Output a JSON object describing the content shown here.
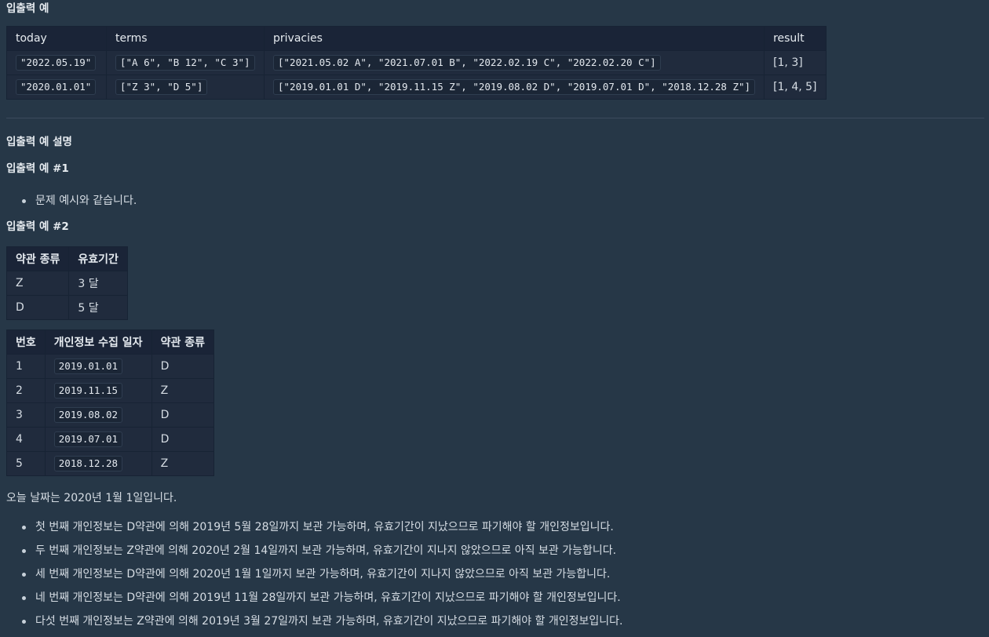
{
  "section1": {
    "title": "입출력 예",
    "headers": [
      "today",
      "terms",
      "privacies",
      "result"
    ],
    "rows": [
      {
        "today": "\"2022.05.19\"",
        "terms": "[\"A 6\", \"B 12\", \"C 3\"]",
        "privacies": "[\"2021.05.02 A\", \"2021.07.01 B\", \"2022.02.19 C\", \"2022.02.20 C\"]",
        "result": "[1, 3]"
      },
      {
        "today": "\"2020.01.01\"",
        "terms": "[\"Z 3\", \"D 5\"]",
        "privacies": "[\"2019.01.01 D\", \"2019.11.15 Z\", \"2019.08.02 D\", \"2019.07.01 D\", \"2018.12.28 Z\"]",
        "result": "[1, 4, 5]"
      }
    ]
  },
  "explain": {
    "title": "입출력 예 설명",
    "ex1": {
      "title": "입출력 예 #1",
      "bullets": [
        "문제 예시와 같습니다."
      ]
    },
    "ex2": {
      "title": "입출력 예 #2",
      "terms_headers": [
        "약관 종류",
        "유효기간"
      ],
      "terms_rows": [
        [
          "Z",
          "3 달"
        ],
        [
          "D",
          "5 달"
        ]
      ],
      "priv_headers": [
        "번호",
        "개인정보 수집 일자",
        "약관 종류"
      ],
      "priv_rows": [
        [
          "1",
          "2019.01.01",
          "D"
        ],
        [
          "2",
          "2019.11.15",
          "Z"
        ],
        [
          "3",
          "2019.08.02",
          "D"
        ],
        [
          "4",
          "2019.07.01",
          "D"
        ],
        [
          "5",
          "2018.12.28",
          "Z"
        ]
      ],
      "today_line": "오늘 날짜는 2020년 1월 1일입니다.",
      "bullets": [
        "첫 번째 개인정보는 D약관에 의해 2019년 5월 28일까지 보관 가능하며, 유효기간이 지났으므로 파기해야 할 개인정보입니다.",
        "두 번째 개인정보는 Z약관에 의해 2020년 2월 14일까지 보관 가능하며, 유효기간이 지나지 않았으므로 아직 보관 가능합니다.",
        "세 번째 개인정보는 D약관에 의해 2020년 1월 1일까지 보관 가능하며, 유효기간이 지나지 않았으므로 아직 보관 가능합니다.",
        "네 번째 개인정보는 D약관에 의해 2019년 11월 28일까지 보관 가능하며, 유효기간이 지났으므로 파기해야 할 개인정보입니다.",
        "다섯 번째 개인정보는 Z약관에 의해 2019년 3월 27일까지 보관 가능하며, 유효기간이 지났으므로 파기해야 할 개인정보입니다."
      ]
    }
  }
}
